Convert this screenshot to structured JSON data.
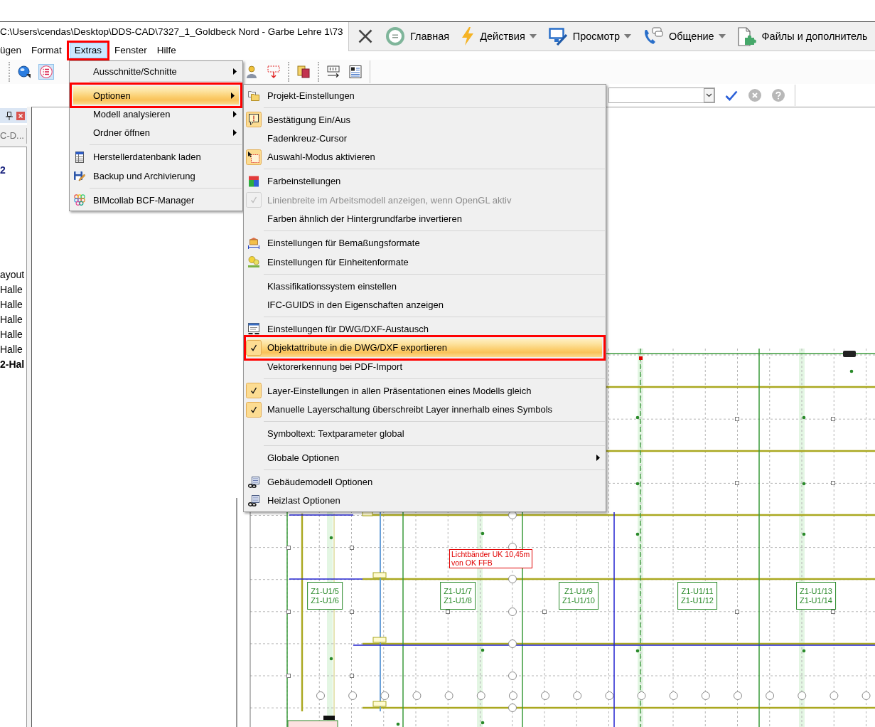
{
  "window": {
    "title": "C:\\Users\\cendas\\Desktop\\DDS-CAD\\7327_1_Goldbeck Nord - Garbe Lehre 1\\73"
  },
  "remote_toolbar": {
    "items": [
      {
        "label": "Главная",
        "dropdown": false
      },
      {
        "label": "Действия",
        "dropdown": true
      },
      {
        "label": "Просмотр",
        "dropdown": true
      },
      {
        "label": "Общение",
        "dropdown": true
      },
      {
        "label": "Файлы и дополнитель",
        "dropdown": false
      }
    ]
  },
  "menubar": {
    "items": [
      {
        "label": "ügen",
        "selected": false,
        "outlined": false
      },
      {
        "label": "Format",
        "selected": false,
        "outlined": false
      },
      {
        "label": "Extras",
        "selected": true,
        "outlined": true
      },
      {
        "label": "Fenster",
        "selected": false,
        "outlined": false
      },
      {
        "label": "Hilfe",
        "selected": false,
        "outlined": false
      }
    ]
  },
  "toolbar": {
    "left": [
      {
        "pressed": false
      },
      {
        "pressed": true
      }
    ],
    "right": [
      {
        "pressed": false
      },
      {
        "pressed": false
      },
      {
        "pressed": false
      },
      {
        "pressed": false
      },
      {
        "pressed": false
      }
    ]
  },
  "extras_menu": {
    "sections": [
      {
        "items": [
          {
            "label": "Ausschnitte/Schnitte",
            "submenu": true,
            "selected": false,
            "outlined": false
          }
        ]
      },
      {
        "items": [
          {
            "label": "Optionen",
            "submenu": true,
            "selected": true,
            "outlined": true
          },
          {
            "label": "Modell analysieren",
            "submenu": true,
            "selected": false,
            "outlined": false
          },
          {
            "label": "Ordner öffnen",
            "submenu": true,
            "selected": false,
            "outlined": false
          }
        ]
      },
      {
        "items": [
          {
            "label": "Herstellerdatenbank laden",
            "submenu": false,
            "selected": false,
            "outlined": false
          },
          {
            "label": "Backup und Archivierung",
            "submenu": false,
            "selected": false,
            "outlined": false
          }
        ]
      },
      {
        "items": [
          {
            "label": "BIMcollab BCF-Manager",
            "submenu": false,
            "selected": false,
            "outlined": false
          }
        ]
      }
    ]
  },
  "options_submenu": {
    "sections": [
      {
        "items": [
          {
            "label": "Projekt-Einstellungen",
            "submenu": false,
            "checked": false,
            "disabled": false,
            "selected": false,
            "outlined": false
          }
        ]
      },
      {
        "items": [
          {
            "label": "Bestätigung Ein/Aus",
            "submenu": false,
            "checked": true,
            "disabled": false,
            "selected": false,
            "outlined": false
          },
          {
            "label": "Fadenkreuz-Cursor",
            "submenu": false,
            "checked": false,
            "disabled": false,
            "selected": false,
            "outlined": false
          },
          {
            "label": "Auswahl-Modus aktivieren",
            "submenu": false,
            "checked": true,
            "disabled": false,
            "selected": false,
            "outlined": false
          }
        ]
      },
      {
        "items": [
          {
            "label": "Farbeinstellungen",
            "submenu": false,
            "checked": false,
            "disabled": false,
            "selected": false,
            "outlined": false
          },
          {
            "label": "Linienbreite im Arbeitsmodell anzeigen, wenn OpenGL aktiv",
            "submenu": false,
            "checked": true,
            "disabled": true,
            "selected": false,
            "outlined": false
          },
          {
            "label": "Farben ähnlich der Hintergrundfarbe invertieren",
            "submenu": false,
            "checked": false,
            "disabled": false,
            "selected": false,
            "outlined": false
          }
        ]
      },
      {
        "items": [
          {
            "label": "Einstellungen für Bemaßungsformate",
            "submenu": false,
            "checked": false,
            "disabled": false,
            "selected": false,
            "outlined": false
          },
          {
            "label": "Einstellungen für Einheitenformate",
            "submenu": false,
            "checked": false,
            "disabled": false,
            "selected": false,
            "outlined": false
          }
        ]
      },
      {
        "items": [
          {
            "label": "Klassifikationssystem einstellen",
            "submenu": false,
            "checked": false,
            "disabled": false,
            "selected": false,
            "outlined": false
          },
          {
            "label": "IFC-GUIDS in den Eigenschaften anzeigen",
            "submenu": false,
            "checked": false,
            "disabled": false,
            "selected": false,
            "outlined": false
          }
        ]
      },
      {
        "items": [
          {
            "label": "Einstellungen für DWG/DXF-Austausch",
            "submenu": false,
            "checked": false,
            "disabled": false,
            "selected": false,
            "outlined": false
          },
          {
            "label": "Objektattribute in die DWG/DXF exportieren",
            "submenu": false,
            "checked": true,
            "disabled": false,
            "selected": true,
            "outlined": true
          },
          {
            "label": "Vektorerkennung bei PDF-Import",
            "submenu": false,
            "checked": false,
            "disabled": false,
            "selected": false,
            "outlined": false
          }
        ]
      },
      {
        "items": [
          {
            "label": "Layer-Einstellungen in allen Präsentationen eines Modells gleich",
            "submenu": false,
            "checked": true,
            "disabled": false,
            "selected": false,
            "outlined": false
          },
          {
            "label": "Manuelle Layerschaltung überschreibt Layer innerhalb eines Symbols",
            "submenu": false,
            "checked": true,
            "disabled": false,
            "selected": false,
            "outlined": false
          }
        ]
      },
      {
        "items": [
          {
            "label": "Symboltext: Textparameter global",
            "submenu": false,
            "checked": false,
            "disabled": false,
            "selected": false,
            "outlined": false
          }
        ]
      },
      {
        "items": [
          {
            "label": "Globale Optionen",
            "submenu": true,
            "checked": false,
            "disabled": false,
            "selected": false,
            "outlined": false
          }
        ]
      },
      {
        "items": [
          {
            "label": "Gebäudemodell Optionen",
            "submenu": false,
            "checked": false,
            "disabled": false,
            "selected": false,
            "outlined": false
          },
          {
            "label": "Heizlast Optionen",
            "submenu": false,
            "checked": false,
            "disabled": false,
            "selected": false,
            "outlined": false
          }
        ]
      }
    ]
  },
  "side_panel": {
    "tab": "C-D...",
    "items": [
      {
        "label": "2",
        "kind": "root",
        "active": true
      },
      {
        "label": "ayout",
        "kind": "item",
        "active": false
      },
      {
        "label": "Halle",
        "kind": "item",
        "active": false
      },
      {
        "label": "Halle",
        "kind": "item",
        "active": false
      },
      {
        "label": "Halle",
        "kind": "item",
        "active": false
      },
      {
        "label": "Halle",
        "kind": "item",
        "active": false
      },
      {
        "label": "Halle",
        "kind": "item",
        "active": false
      },
      {
        "label": "2-Hal",
        "kind": "item",
        "active": true
      }
    ]
  },
  "drawing": {
    "room_tags": [
      {
        "lines": [
          "Z1-U1/5",
          "Z1-U1/6"
        ]
      },
      {
        "lines": [
          "Z1-U1/7",
          "Z1-U1/8"
        ]
      },
      {
        "lines": [
          "Z1-U1/9",
          "Z1-U1/10"
        ]
      },
      {
        "lines": [
          "Z1-U1/11",
          "Z1-U1/12"
        ]
      },
      {
        "lines": [
          "Z1-U1/13",
          "Z1-U1/14"
        ]
      }
    ],
    "note": {
      "lines": [
        "Lichtbänder UK 10,45m",
        "von OK FFB"
      ]
    }
  }
}
